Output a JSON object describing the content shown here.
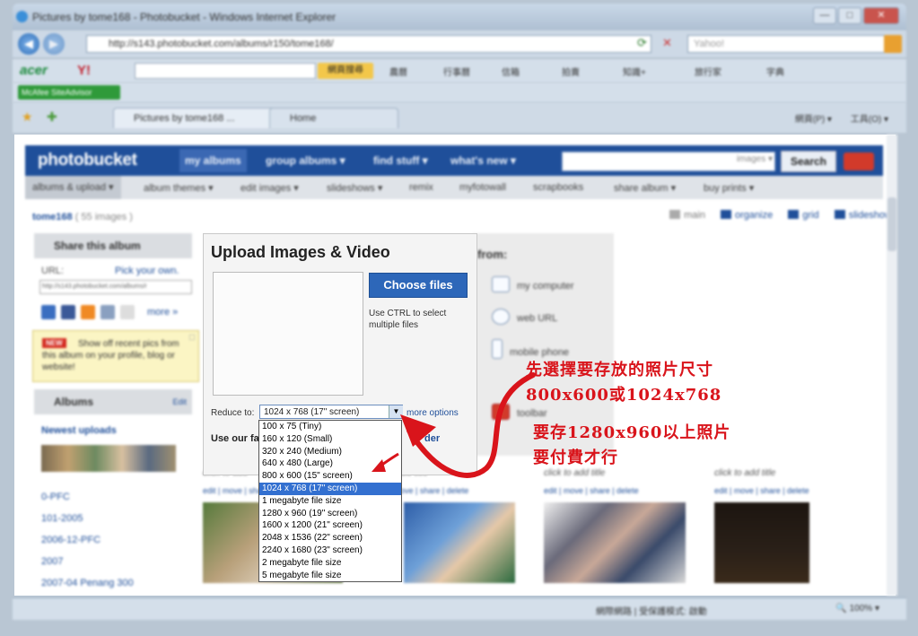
{
  "window": {
    "title": "Pictures by tome168 - Photobucket - Windows Internet Explorer",
    "address": "http://s143.photobucket.com/albums/r150/tome168/",
    "search_placeholder": "Yahoo!",
    "min": "—",
    "max": "□",
    "close": "✕"
  },
  "toolbars": {
    "acer_logo": "acer",
    "yahoo_logo": "Y!",
    "search_btn": "網頁搜尋",
    "items": [
      "農曆",
      "行事曆",
      "信箱",
      "拍賣",
      "知識+",
      "旅行家",
      "字典"
    ],
    "mcafee": "McAfee SiteAdvisor"
  },
  "tabs": {
    "active": "Pictures by tome168 ...",
    "other": "Home",
    "right_tools": [
      "網頁(P) ▾",
      "工具(O) ▾"
    ]
  },
  "photobucket": {
    "logo": "photobucket",
    "nav": [
      "my albums",
      "group albums ▾",
      "find stuff ▾",
      "what's new ▾"
    ],
    "search_scope": "images ▾",
    "search_btn": "Search",
    "subnav": [
      "albums & upload ▾",
      "album themes ▾",
      "edit images ▾",
      "slideshows ▾",
      "remix",
      "myfotowall",
      "scrapbooks",
      "share album ▾",
      "buy prints ▾"
    ],
    "user": "tome168",
    "count": "( 55 images )",
    "views": [
      "main",
      "organize",
      "grid",
      "slideshow"
    ]
  },
  "sidebar": {
    "share_title": "Share this album",
    "url_label": "URL:",
    "pick_own": "Pick your own.",
    "url_value": "http://s143.photobucket.com/albums/r",
    "more": "more »",
    "tip_badge": "NEW",
    "tip_text": "Show off recent pics from this album on your profile, blog or website!",
    "albums_title": "Albums",
    "albums_edit": "Edit",
    "newest": "Newest uploads",
    "album_list": [
      "0-PFC",
      "101-2005",
      "2006-12-PFC",
      "2007",
      "2007-04 Penang 300"
    ]
  },
  "upload": {
    "title": "Upload Images & Video",
    "choose": "Choose files",
    "ctrl_hint": "Use CTRL to select multiple files",
    "reduce_label": "Reduce to:",
    "reduce_value": "1024 x 768 (17\" screen)",
    "more_options": "more options",
    "use_family": "Use our fa",
    "uploader": "der",
    "from_label": "from:",
    "sources": [
      "my computer",
      "web URL",
      "mobile phone",
      "toolbar"
    ]
  },
  "dropdown": {
    "options": [
      "100 x 75 (Tiny)",
      "160 x 120 (Small)",
      "320 x 240 (Medium)",
      "640 x 480 (Large)",
      "800 x 600 (15\" screen)",
      "1024 x 768 (17\" screen)",
      "1 megabyte file size",
      "1280 x 960 (19\" screen)",
      "1600 x 1200 (21\" screen)",
      "2048 x 1536 (22\" screen)",
      "2240 x 1680 (23\" screen)",
      "2 megabyte file size",
      "5 megabyte file size"
    ],
    "selected_index": 5
  },
  "photos": {
    "caption": "click to add title",
    "caption_short": "click to add",
    "caption_tail": "add title",
    "controls": "edit | move | share | delete",
    "controls_tail": "ove | share | delete"
  },
  "annotation": {
    "line1": "先選擇要存放的照片尺寸",
    "line2": "800x600或1024x768",
    "line3": "要存1280x960以上照片",
    "line4": "要付費才行",
    "color": "#d9141b"
  },
  "status": {
    "zone": "網際網路 | 受保護模式: 啟動",
    "zoom": "🔍 100% ▾"
  }
}
